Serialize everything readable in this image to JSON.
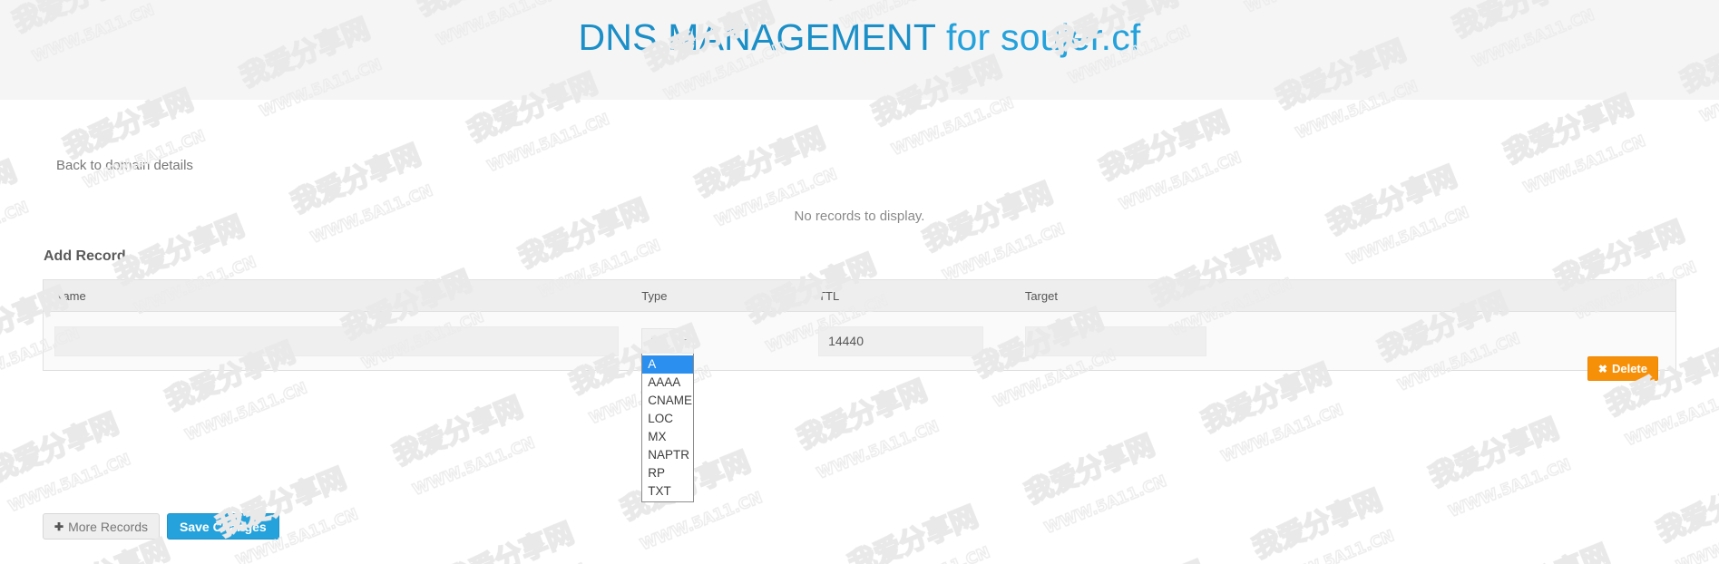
{
  "header": {
    "title_prefix": "DNS MANAGEMENT",
    "title_suffix": " for soujer.cf",
    "accent_color": "#25a2db",
    "band_color": "#f5f5f5"
  },
  "content": {
    "back_link": "Back to domain details",
    "no_records_message": "No records to display.",
    "add_record_title": "Add Record"
  },
  "table": {
    "columns": [
      "Name",
      "Type",
      "TTL",
      "Target"
    ],
    "rows": [
      {
        "name_value": "",
        "name_placeholder": "",
        "type_value": "A",
        "ttl_value": "14440",
        "target_value": "",
        "target_placeholder": "",
        "delete_label": "Delete",
        "delete_icon": "close-x-icon",
        "delete_color": "#f79009"
      }
    ]
  },
  "type_select": {
    "selected": "A",
    "open": true,
    "options": [
      "A",
      "AAAA",
      "CNAME",
      "LOC",
      "MX",
      "NAPTR",
      "RP",
      "TXT"
    ],
    "highlight_color": "#2a8fef",
    "arrow_icon": "chevron-down-icon"
  },
  "footer": {
    "more_records_label": "More Records",
    "more_records_icon": "plus-icon",
    "save_changes_label": "Save Changes",
    "save_color": "#25a2db"
  },
  "watermark": {
    "text_a": "我爱分享网",
    "text_b": "WWW.5A11.CN"
  }
}
